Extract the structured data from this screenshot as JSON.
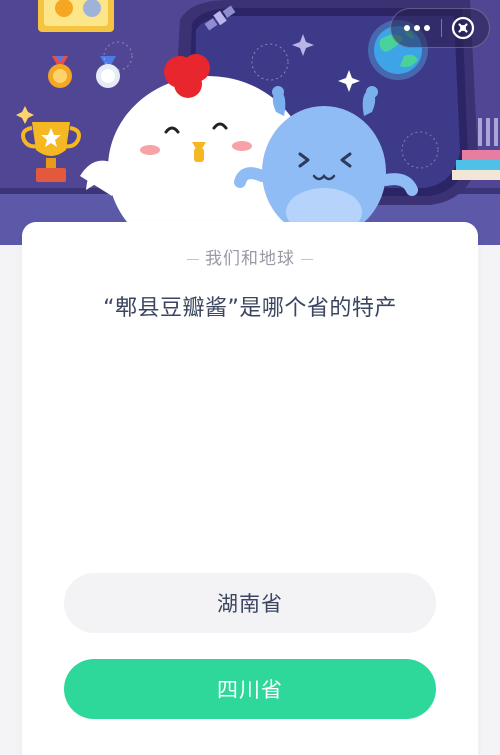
{
  "header": {
    "more_icon": "more-dots-icon",
    "close_icon": "close-circle-icon"
  },
  "card": {
    "category": "我们和地球",
    "question": "“郫县豆瓣酱”是哪个省的特产",
    "options": [
      {
        "label": "湖南省"
      },
      {
        "label": "四川省"
      }
    ]
  },
  "colors": {
    "banner": "#5a4e9c",
    "option_default": "#f3f3f6",
    "option_selected": "#2ed89b",
    "question_text": "#3b4560",
    "category_text": "#9a9aa6"
  }
}
